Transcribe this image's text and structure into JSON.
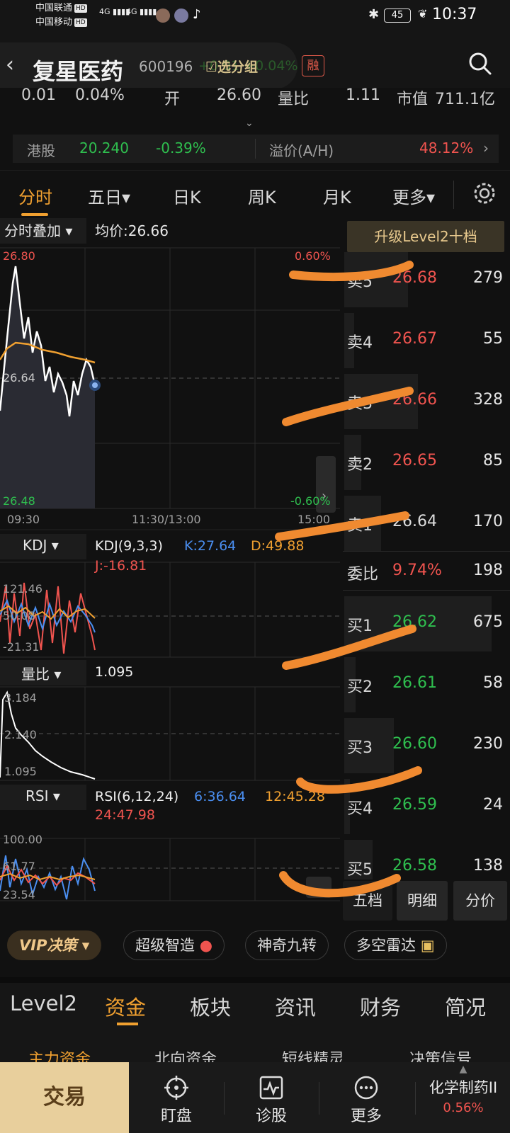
{
  "status_bar": {
    "carrier1": "中国联通",
    "carrier2": "中国移动",
    "hd_badge": "HD",
    "net1": "4G",
    "net2": "4G",
    "battery": "45",
    "time": "10:37"
  },
  "header": {
    "stock_name": "复星医药",
    "stock_code": "600196",
    "add_group_label": "选分组",
    "rong_badge": "融",
    "faded_change": "+0.01 +0.04%"
  },
  "quote_strip": {
    "change": "0.01",
    "change_pct": "0.04%",
    "open_label": "开",
    "open_value": "26.60",
    "ratio_label": "量比",
    "ratio_value": "1.11",
    "mktcap_label": "市值",
    "mktcap_value": "711.1亿"
  },
  "hk_row": {
    "label": "港股",
    "price": "20.240",
    "change_pct": "-0.39%",
    "premium_label": "溢价(A/H)",
    "premium_value": "48.12%"
  },
  "tabs": [
    {
      "label": "分时",
      "active": true
    },
    {
      "label": "五日▾",
      "active": false
    },
    {
      "label": "日K",
      "active": false
    },
    {
      "label": "周K",
      "active": false
    },
    {
      "label": "月K",
      "active": false
    },
    {
      "label": "更多▾",
      "active": false
    }
  ],
  "intraday": {
    "overlay_label": "分时叠加 ▾",
    "avg_label": "均价:26.66",
    "price_high": "26.80",
    "price_mid": "26.64",
    "price_low": "26.48",
    "pct_high": "0.60%",
    "pct_low": "-0.60%",
    "time_start": "09:30",
    "time_mid": "11:30/13:00",
    "time_end": "15:00"
  },
  "kdj": {
    "label": "KDJ ▾",
    "params": "KDJ(9,3,3)",
    "k": "K:27.64",
    "d": "D:49.88",
    "j": "J:-16.81",
    "axis_high": "121.46",
    "axis_mid": "50.08",
    "axis_low": "-21.31"
  },
  "volume_ratio": {
    "label": "量比 ▾",
    "value": "1.095",
    "axis_high": "3.184",
    "axis_mid": "2.140",
    "axis_low": "1.095"
  },
  "rsi": {
    "label": "RSI ▾",
    "params": "RSI(6,12,24)",
    "r6": "6:36.64",
    "r12": "12:45.28",
    "r24": "24:47.98",
    "axis_high": "100.00",
    "axis_mid": "61.77",
    "axis_low": "23.54"
  },
  "order_book": {
    "upgrade_label": "升级Level2十档",
    "asks": [
      {
        "label": "卖5",
        "price": "26.68",
        "volume": "279"
      },
      {
        "label": "卖4",
        "price": "26.67",
        "volume": "55"
      },
      {
        "label": "卖3",
        "price": "26.66",
        "volume": "328"
      },
      {
        "label": "卖2",
        "price": "26.65",
        "volume": "85"
      },
      {
        "label": "卖1",
        "price": "26.64",
        "volume": "170"
      }
    ],
    "ratio_label": "委比",
    "ratio_value": "9.74%",
    "ratio_diff": "198",
    "bids": [
      {
        "label": "买1",
        "price": "26.62",
        "volume": "675"
      },
      {
        "label": "买2",
        "price": "26.61",
        "volume": "58"
      },
      {
        "label": "买3",
        "price": "26.60",
        "volume": "230"
      },
      {
        "label": "买4",
        "price": "26.59",
        "volume": "24"
      },
      {
        "label": "买5",
        "price": "26.58",
        "volume": "138"
      }
    ],
    "btn_five": "五档",
    "btn_detail": "明细",
    "btn_price": "分价"
  },
  "tools": {
    "vip": "VIP决策 ▾",
    "tool1": "超级智造",
    "tool2": "神奇九转",
    "tool3": "多空雷达"
  },
  "bottom_tabs": [
    "Level2",
    "资金",
    "板块",
    "资讯",
    "财务",
    "简况"
  ],
  "sub_tabs": [
    "主力资金",
    "北向资金",
    "短线精灵",
    "决策信号"
  ],
  "bottom_nav": {
    "trade": "交易",
    "watch": "盯盘",
    "diagnose": "诊股",
    "more": "更多",
    "sector_name": "化学制药II",
    "sector_change": "0.56%"
  },
  "colors": {
    "up": "#f0544f",
    "down": "#2fbf4f",
    "accent": "#f0a030",
    "annotation": "#f08a30"
  }
}
